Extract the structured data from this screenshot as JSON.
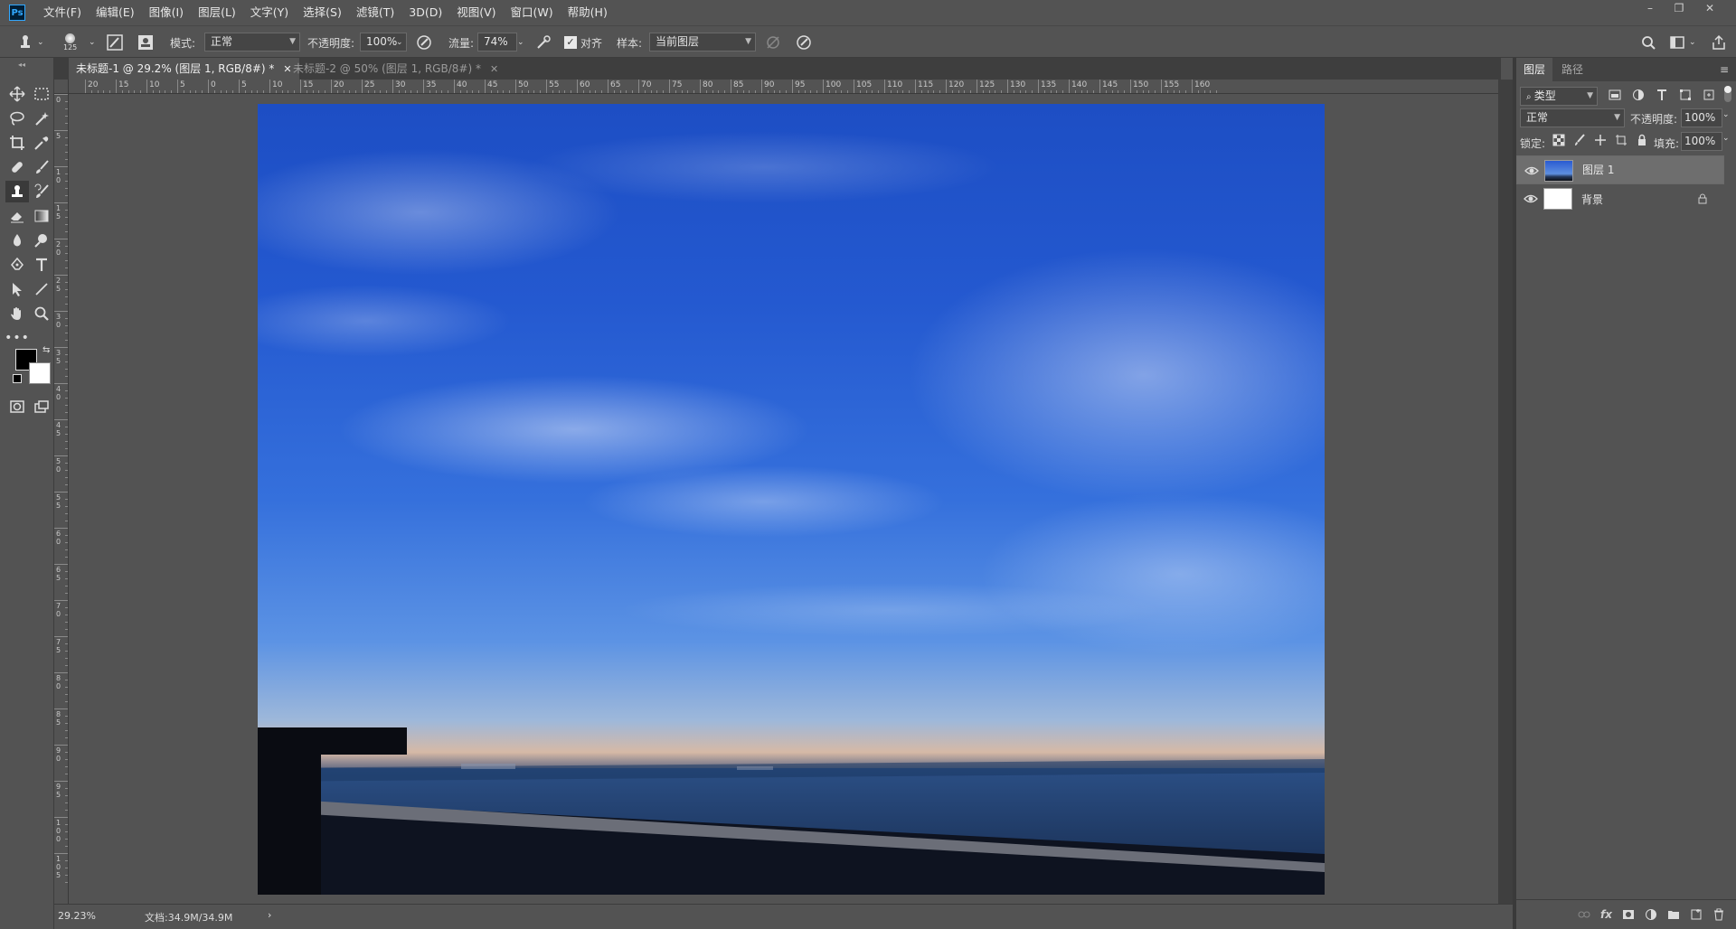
{
  "app": {
    "logo": "Ps"
  },
  "menu": [
    "文件(F)",
    "编辑(E)",
    "图像(I)",
    "图层(L)",
    "文字(Y)",
    "选择(S)",
    "滤镜(T)",
    "3D(D)",
    "视图(V)",
    "窗口(W)",
    "帮助(H)"
  ],
  "window_controls": {
    "minimize": "–",
    "restore": "❐",
    "close": "✕"
  },
  "options": {
    "brush_size": "125",
    "mode_label": "模式:",
    "mode_value": "正常",
    "opacity_label": "不透明度:",
    "opacity_value": "100%",
    "flow_label": "流量:",
    "flow_value": "74%",
    "align_label": "对齐",
    "align_checked": true,
    "sample_label": "样本:",
    "sample_value": "当前图层"
  },
  "tabs": [
    {
      "label": "未标题-1 @ 29.2% (图层 1, RGB/8#) *",
      "active": true
    },
    {
      "label": "未标题-2 @ 50% (图层 1, RGB/8#) *",
      "active": false
    }
  ],
  "ruler_h": [
    "20",
    "15",
    "10",
    "5",
    "0",
    "5",
    "10",
    "15",
    "20",
    "25",
    "30",
    "35",
    "40",
    "45",
    "50",
    "55",
    "60",
    "65",
    "70",
    "75",
    "80",
    "85",
    "90",
    "95",
    "100",
    "105",
    "110",
    "115",
    "120",
    "125",
    "130",
    "135",
    "140",
    "145",
    "150",
    "155",
    "160"
  ],
  "ruler_v": [
    "0",
    "5",
    "1 0",
    "1 5",
    "2 0",
    "2 5",
    "3 0",
    "3 5",
    "4 0",
    "4 5",
    "5 0",
    "5 5",
    "6 0",
    "6 5",
    "7 0",
    "7 5",
    "8 0",
    "8 5",
    "9 0",
    "9 5",
    "1 0 0",
    "1 0 5"
  ],
  "status": {
    "zoom": "29.23%",
    "doc": "文档:34.9M/34.9M",
    "arrow": "›"
  },
  "panel": {
    "tabs": [
      "图层",
      "路径"
    ],
    "filter_label": "类型",
    "blend_mode": "正常",
    "opacity_label": "不透明度:",
    "opacity_value": "100%",
    "lock_label": "锁定:",
    "fill_label": "填充:",
    "fill_value": "100%",
    "layers": [
      {
        "name": "图层 1",
        "selected": true,
        "locked": false
      },
      {
        "name": "背景",
        "selected": false,
        "locked": true
      }
    ],
    "footer_fx": "fx"
  },
  "colors": {
    "foreground": "#000000",
    "background": "#ffffff",
    "ui_bg": "#535353",
    "accent": "#31a8ff"
  }
}
